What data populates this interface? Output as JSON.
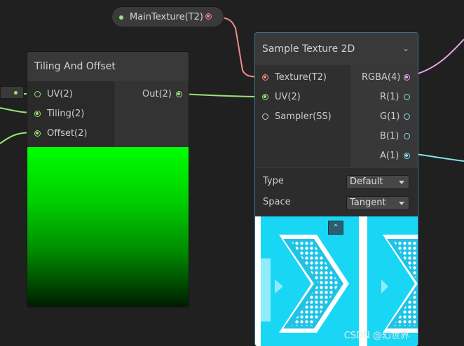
{
  "property_node": {
    "label": "MainTexture(T2)"
  },
  "tiling_node": {
    "title": "Tiling And Offset",
    "inputs": [
      "UV(2)",
      "Tiling(2)",
      "Offset(2)"
    ],
    "output": "Out(2)"
  },
  "sample_node": {
    "title": "Sample Texture 2D",
    "inputs": [
      "Texture(T2)",
      "UV(2)",
      "Sampler(SS)"
    ],
    "outputs": [
      "RGBA(4)",
      "R(1)",
      "G(1)",
      "B(1)",
      "A(1)"
    ],
    "settings": {
      "type_label": "Type",
      "type_value": "Default",
      "space_label": "Space",
      "space_value": "Tangent"
    }
  },
  "watermark": "CSDN @幻世界",
  "colors": {
    "texture_wire": "#f08a8a",
    "vector2_wire": "#9be37a",
    "vector4_wire": "#e7a6e8",
    "float_wire": "#84e2e8",
    "selection": "#3f6f86"
  }
}
